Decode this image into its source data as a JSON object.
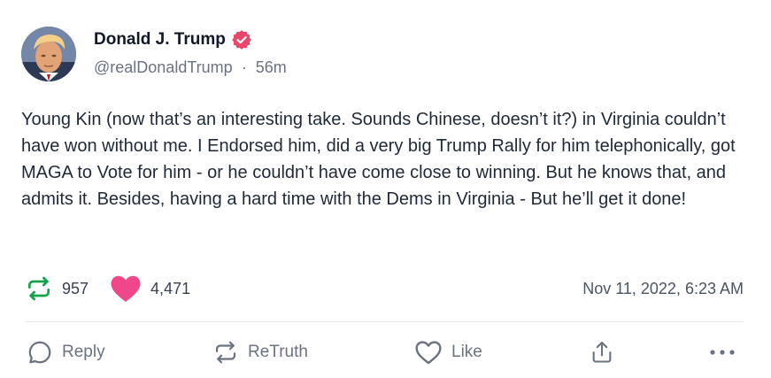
{
  "author": {
    "display_name": "Donald J. Trump",
    "handle": "@realDonaldTrump",
    "separator": "·",
    "time_ago": "56m",
    "verified": true
  },
  "post": {
    "text": "Young Kin (now that’s an interesting take. Sounds Chinese, doesn’t it?) in Virginia couldn’t have won without me. I Endorsed him, did a very big Trump Rally for him telephonically, got MAGA to Vote for him - or he couldn’t have come close to winning. But he knows that, and admits it. Besides, having a hard time with the Dems in Virginia - But he’ll get it done!"
  },
  "stats": {
    "retruths": "957",
    "likes": "4,471",
    "timestamp": "Nov 11, 2022, 6:23 AM"
  },
  "actions": {
    "reply_label": "Reply",
    "retruth_label": "ReTruth",
    "like_label": "Like"
  },
  "icons": {
    "verified": "verified-badge-icon",
    "retruth_stat": "retruth-icon",
    "like_stat": "heart-filled-icon",
    "reply": "speech-bubble-icon",
    "retruth": "retruth-icon",
    "like": "heart-outline-icon",
    "share": "share-upload-icon",
    "more": "ellipsis-icon"
  },
  "colors": {
    "verified": "#e9486b",
    "retruth_green": "#16a34a",
    "like_pink": "#f0478a",
    "muted": "#6b7280"
  }
}
